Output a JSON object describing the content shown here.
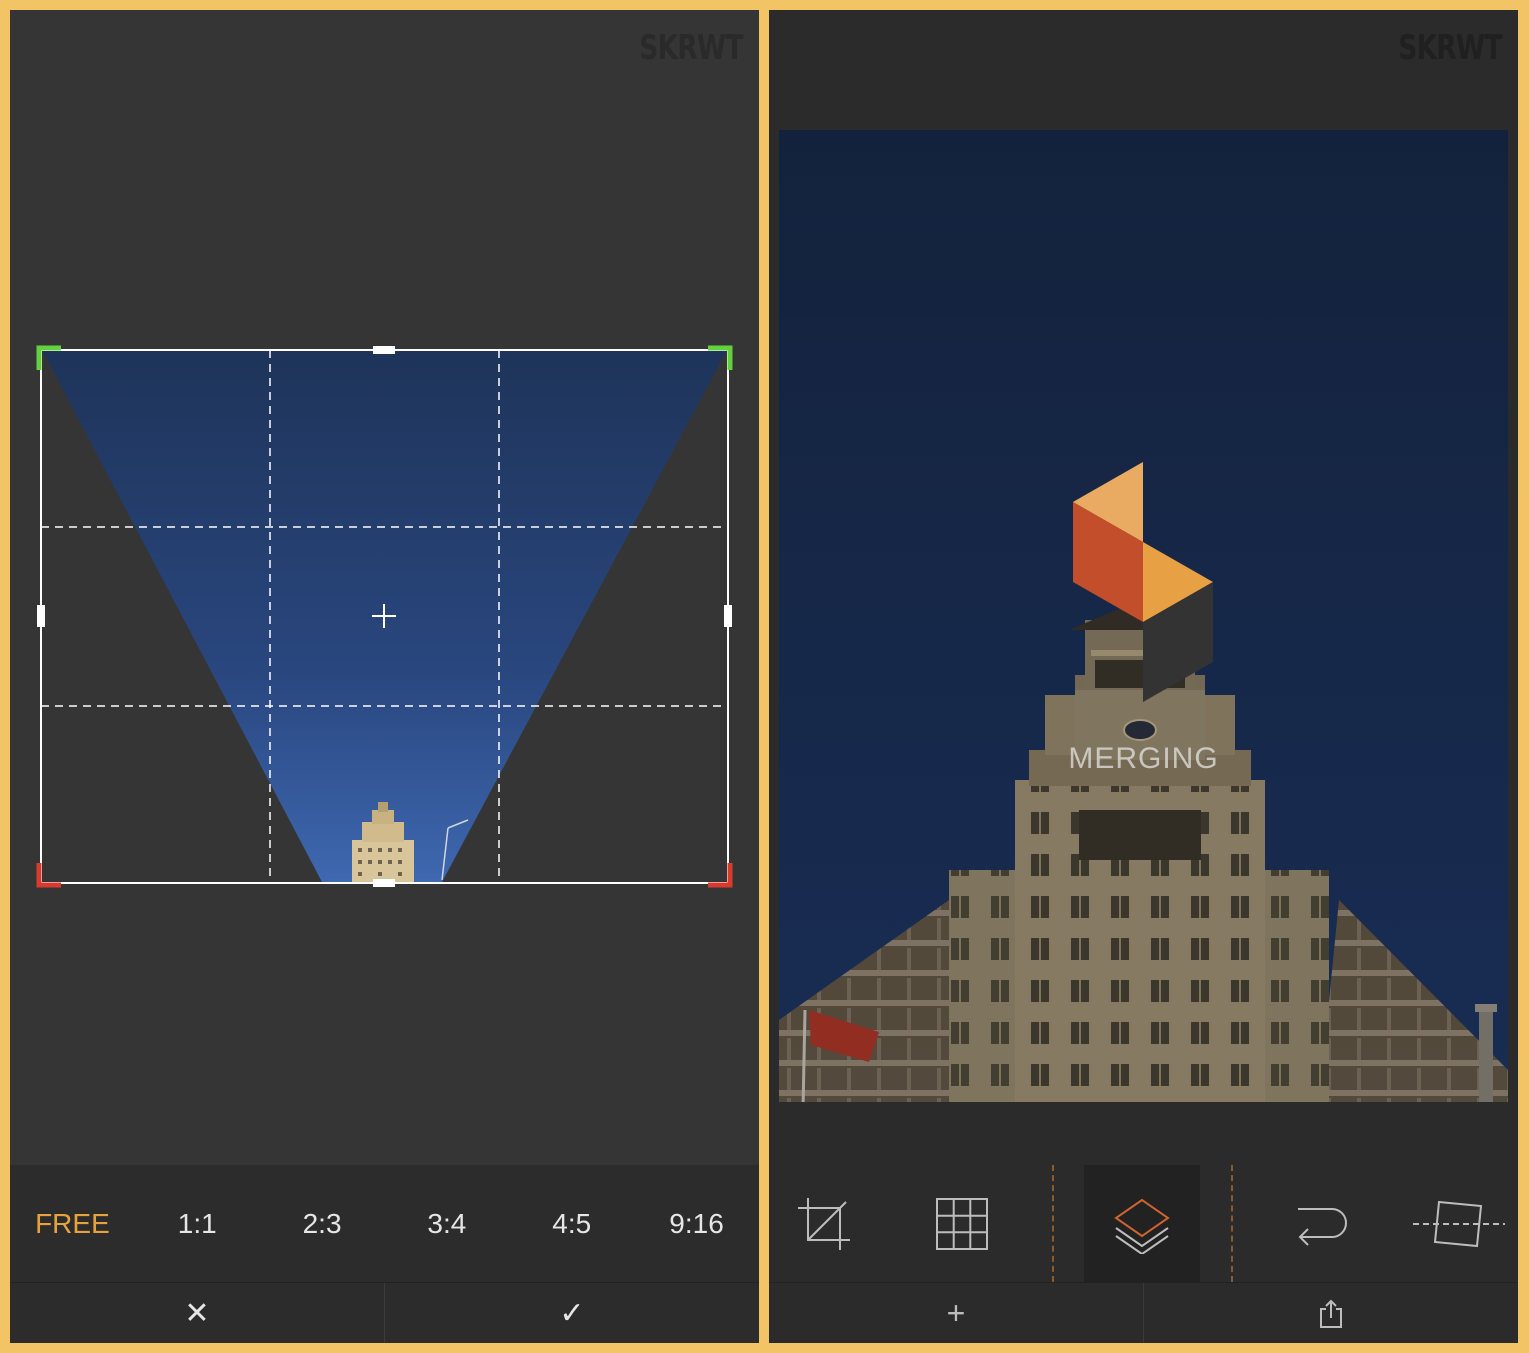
{
  "left_screen": {
    "watermark": "SKRWT",
    "aspect_ratios": [
      "FREE",
      "1:1",
      "2:3",
      "3:4",
      "4:5",
      "9:16"
    ],
    "selected_ratio": "FREE",
    "accent_color": "#e8a23d",
    "actions": {
      "cancel": "✕",
      "confirm": "✓"
    }
  },
  "right_screen": {
    "watermark": "SKRWT",
    "status_text": "MERGING",
    "tools": [
      "crop-icon",
      "grid-icon",
      "layers-icon",
      "undo-icon",
      "perspective-icon"
    ],
    "selected_tool": "layers-icon",
    "bottom_actions": {
      "add": "+",
      "share": "share-icon"
    },
    "logo_colors": [
      "#e8a245",
      "#c84f2b",
      "#333333"
    ]
  }
}
